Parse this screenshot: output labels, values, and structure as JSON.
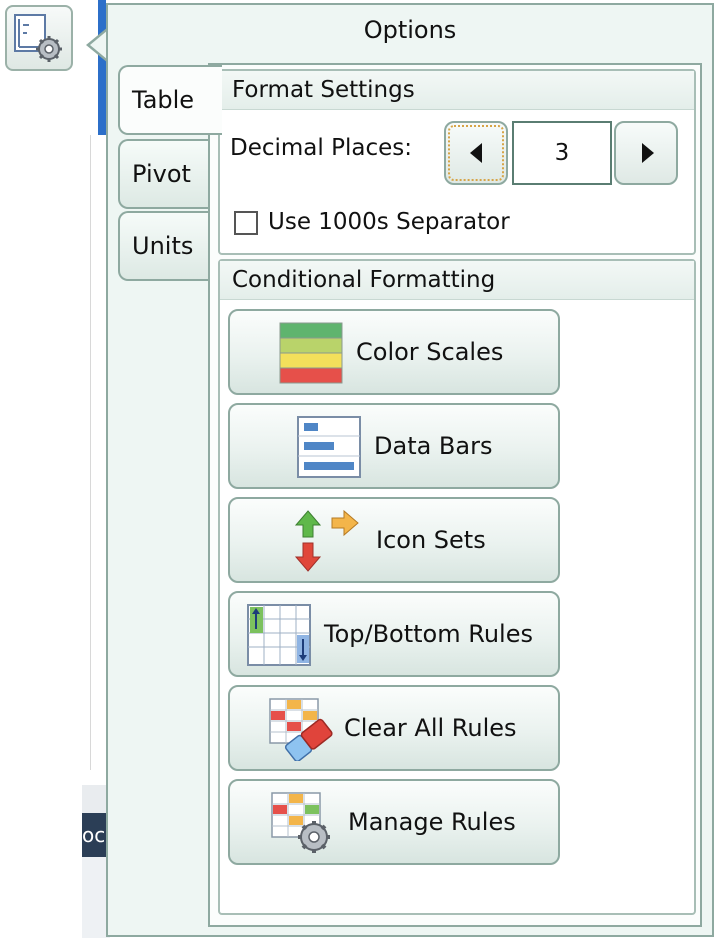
{
  "window": {
    "title": "Options"
  },
  "tabs": [
    {
      "label": "Table",
      "active": true
    },
    {
      "label": "Pivot",
      "active": false
    },
    {
      "label": "Units",
      "active": false
    }
  ],
  "format_settings": {
    "header": "Format Settings",
    "decimal_label": "Decimal Places:",
    "decimal_value": "3",
    "separator_label": "Use 1000s Separator",
    "separator_checked": false
  },
  "conditional_formatting": {
    "header": "Conditional Formatting",
    "buttons": [
      {
        "label": "Color Scales",
        "icon": "color-scales-icon"
      },
      {
        "label": "Data Bars",
        "icon": "data-bars-icon"
      },
      {
        "label": "Icon Sets",
        "icon": "icon-sets-icon"
      },
      {
        "label": "Top/Bottom Rules",
        "icon": "top-bottom-rules-icon"
      },
      {
        "label": "Clear All Rules",
        "icon": "clear-rules-icon"
      },
      {
        "label": "Manage Rules",
        "icon": "manage-rules-icon"
      }
    ]
  },
  "background_app": {
    "partial_text": "oc"
  },
  "colors": {
    "accent_blue": "#2c6fc9",
    "panel_bg": "#eef6f3",
    "border": "#8ea9a0"
  }
}
